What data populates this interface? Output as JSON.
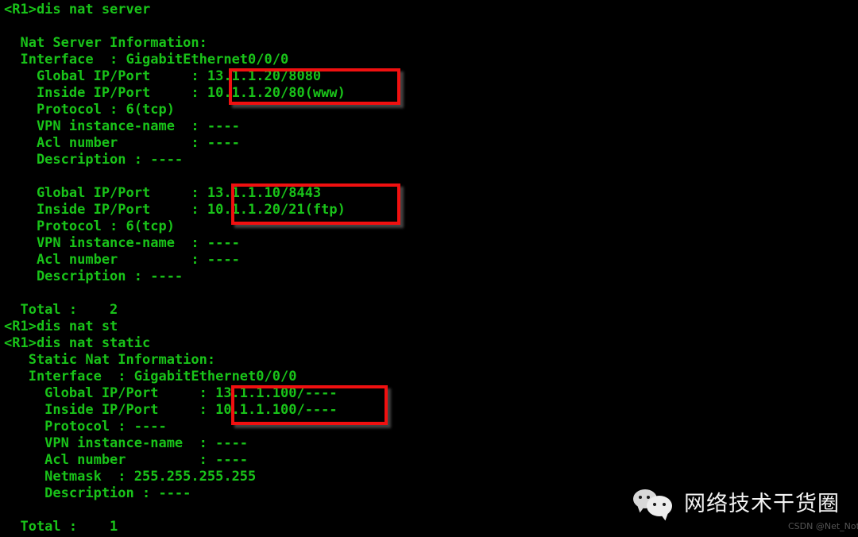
{
  "terminal": {
    "prompt_1": "<R1>dis nat server",
    "prompt_2": "<R1>dis nat st",
    "prompt_3": "<R1>dis nat static",
    "lines": [
      "<R1>dis nat server",
      "",
      "  Nat Server Information:",
      "  Interface  : GigabitEthernet0/0/0",
      "    Global IP/Port     : 13.1.1.20/8080",
      "    Inside IP/Port     : 10.1.1.20/80(www)",
      "    Protocol : 6(tcp)",
      "    VPN instance-name  : ----",
      "    Acl number         : ----",
      "    Description : ----",
      "",
      "    Global IP/Port     : 13.1.1.10/8443",
      "    Inside IP/Port     : 10.1.1.20/21(ftp)",
      "    Protocol : 6(tcp)",
      "    VPN instance-name  : ----",
      "    Acl number         : ----",
      "    Description : ----",
      "",
      "  Total :    2",
      "<R1>dis nat st",
      "<R1>dis nat static",
      "   Static Nat Information:",
      "   Interface  : GigabitEthernet0/0/0",
      "     Global IP/Port     : 13.1.1.100/----",
      "     Inside IP/Port     : 10.1.1.100/----",
      "     Protocol : ----",
      "     VPN instance-name  : ----",
      "     Acl number         : ----",
      "     Netmask  : 255.255.255.255",
      "     Description : ----",
      "",
      "  Total :    1"
    ],
    "nat_server": {
      "header": "Nat Server Information:",
      "interface_label": "Interface",
      "interface_value": "GigabitEthernet0/0/0",
      "entries": [
        {
          "global_ip_port_label": "Global IP/Port",
          "global_ip_port_value": "13.1.1.20/8080",
          "inside_ip_port_label": "Inside IP/Port",
          "inside_ip_port_value": "10.1.1.20/80(www)",
          "protocol_label": "Protocol",
          "protocol_value": "6(tcp)",
          "vpn_instance_label": "VPN instance-name",
          "vpn_instance_value": "----",
          "acl_number_label": "Acl number",
          "acl_number_value": "----",
          "description_label": "Description",
          "description_value": "----"
        },
        {
          "global_ip_port_label": "Global IP/Port",
          "global_ip_port_value": "13.1.1.10/8443",
          "inside_ip_port_label": "Inside IP/Port",
          "inside_ip_port_value": "10.1.1.20/21(ftp)",
          "protocol_label": "Protocol",
          "protocol_value": "6(tcp)",
          "vpn_instance_label": "VPN instance-name",
          "vpn_instance_value": "----",
          "acl_number_label": "Acl number",
          "acl_number_value": "----",
          "description_label": "Description",
          "description_value": "----"
        }
      ],
      "total_label": "Total :",
      "total_value": "2"
    },
    "static_nat": {
      "header": "Static Nat Information:",
      "interface_label": "Interface",
      "interface_value": "GigabitEthernet0/0/0",
      "entries": [
        {
          "global_ip_port_label": "Global IP/Port",
          "global_ip_port_value": "13.1.1.100/----",
          "inside_ip_port_label": "Inside IP/Port",
          "inside_ip_port_value": "10.1.1.100/----",
          "protocol_label": "Protocol",
          "protocol_value": "----",
          "vpn_instance_label": "VPN instance-name",
          "vpn_instance_value": "----",
          "acl_number_label": "Acl number",
          "acl_number_value": "----",
          "netmask_label": "Netmask",
          "netmask_value": "255.255.255.255",
          "description_label": "Description",
          "description_value": "----"
        }
      ],
      "total_label": "Total :",
      "total_value": "1"
    },
    "colors": {
      "background": "#000000",
      "text": "#19c319",
      "highlight_border": "#f01010"
    }
  },
  "annotations": {
    "highlight_1": "13.1.1.20/8080 , 10.1.1.20/80(www)",
    "highlight_2": "13.1.1.10/8443 , 10.1.1.20/21(ftp)",
    "highlight_3": "13.1.1.100/---- , 10.1.1.100/----"
  },
  "watermark": {
    "logo_icon": "wechat-icon",
    "text": "网络技术干货圈",
    "credit": "CSDN @Net_Not",
    "text_color": "#f2f2f2",
    "credit_color": "#555555"
  }
}
